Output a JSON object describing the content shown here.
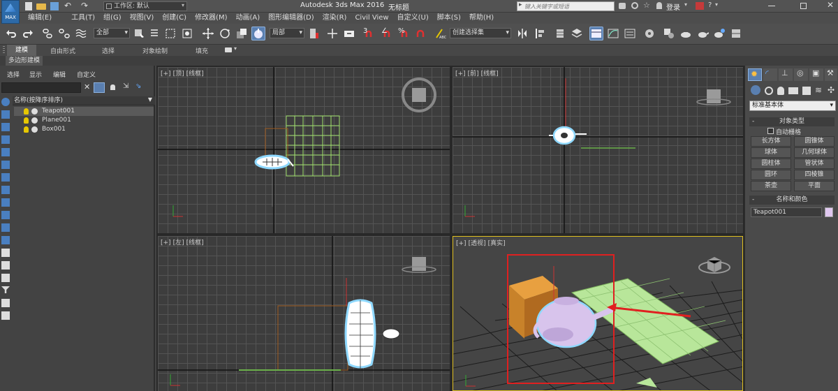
{
  "titlebar": {
    "app_logo": "MAX",
    "workspace_label": "工作区: 默认",
    "app_title": "Autodesk 3ds Max 2016",
    "doc_title": "无标题",
    "search_placeholder": "键入关键字或短语",
    "login_label": "登录"
  },
  "menubar": {
    "items": [
      "编辑(E)",
      "工具(T)",
      "组(G)",
      "视图(V)",
      "创建(C)",
      "修改器(M)",
      "动画(A)",
      "图形编辑器(D)",
      "渲染(R)",
      "Civil View",
      "自定义(U)",
      "脚本(S)",
      "帮助(H)"
    ]
  },
  "toolbar": {
    "filter_value": "全部",
    "coord_value": "局部",
    "selset_value": "创建选择集",
    "snap_label": "3",
    "angle_label": "∠",
    "pct_label": "%"
  },
  "ribbon": {
    "tabs": [
      "建模",
      "自由形式",
      "选择",
      "对象绘制",
      "填充"
    ],
    "sub_label": "多边形建模"
  },
  "explorer": {
    "tabs": [
      "选择",
      "显示",
      "编辑",
      "自定义"
    ],
    "column_header": "名称(按降序排序)",
    "items": [
      "Teapot001",
      "Plane001",
      "Box001"
    ]
  },
  "viewports": {
    "top": [
      "[+]",
      "[顶]",
      "[线框]"
    ],
    "front": [
      "[+]",
      "[前]",
      "[线框]"
    ],
    "left": [
      "[+]",
      "[左]",
      "[线框]"
    ],
    "persp": [
      "[+]",
      "[透视]",
      "[真实]"
    ]
  },
  "cmdpanel": {
    "category_value": "标准基本体",
    "object_type_header": "对象类型",
    "autogrid_label": "自动栅格",
    "buttons": [
      "长方体",
      "圆锥体",
      "球体",
      "几何球体",
      "圆柱体",
      "管状体",
      "圆环",
      "四棱锥",
      "茶壶",
      "平面"
    ],
    "name_color_header": "名称和颜色",
    "name_value": "Teapot001",
    "swatch_color": "#e0c8f0"
  },
  "colors": {
    "selection_outline": "#8ed8ff",
    "annotation_red": "#e02020",
    "plane_green": "#b8e69a",
    "box_orange": "#c8822a",
    "teapot_lilac": "#d8c4ec",
    "viewport_active_border": "#e0c020"
  }
}
